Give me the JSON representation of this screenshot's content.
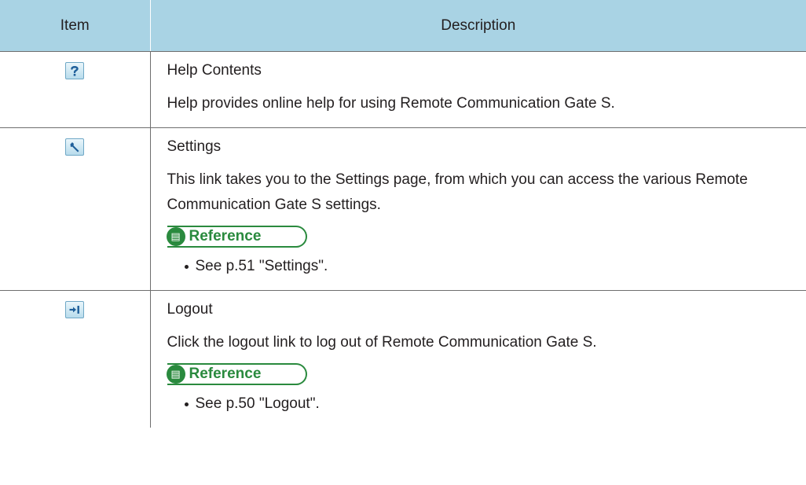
{
  "table": {
    "header": {
      "item": "Item",
      "description": "Description"
    },
    "rows": [
      {
        "icon": "help-icon",
        "name": "Help Contents",
        "text": "Help provides online help for using Remote Communication Gate S."
      },
      {
        "icon": "wrench-icon",
        "name": "Settings",
        "text": "This link takes you to the Settings page, from which you can access the various Remote Communication Gate S settings.",
        "reference_label": "Reference",
        "reference_items": [
          "See p.51 \"Settings\"."
        ]
      },
      {
        "icon": "logout-icon",
        "name": "Logout",
        "text": "Click the logout link to log out of Remote Communication Gate S.",
        "reference_label": "Reference",
        "reference_items": [
          "See p.50 \"Logout\"."
        ]
      }
    ]
  },
  "colors": {
    "header_bg": "#a9d3e4",
    "reference_green": "#2a8a3e",
    "icon_blue": "#1f5f9a"
  }
}
